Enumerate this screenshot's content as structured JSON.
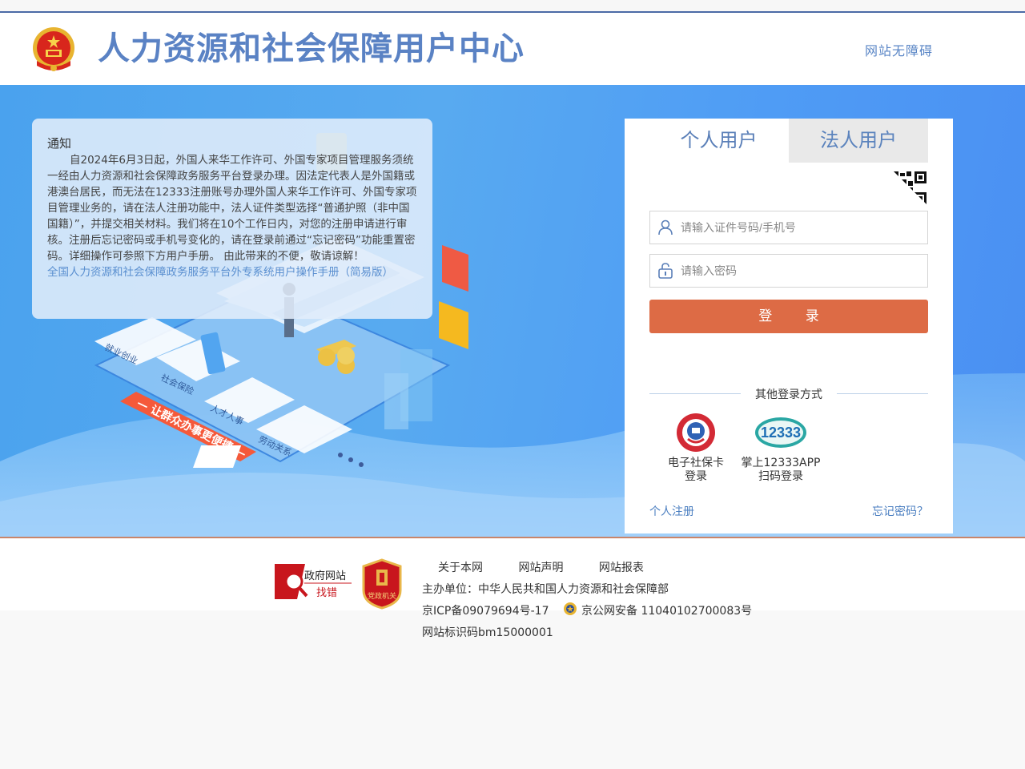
{
  "header": {
    "title": "人力资源和社会保障用户中心",
    "accessibility": "网站无障碍"
  },
  "notice": {
    "title": "通知",
    "body": "自2024年6月3日起，外国人来华工作许可、外国专家项目管理服务须统一经由人力资源和社会保障政务服务平台登录办理。因法定代表人是外国籍或港澳台居民，而无法在12333注册账号办理外国人来华工作许可、外国专家项目管理业务的，请在法人注册功能中，法人证件类型选择“普通护照（非中国国籍）”，并提交相关材料。我们将在10个工作日内，对您的注册申请进行审核。注册后忘记密码或手机号变化的，请在登录前通过“忘记密码”功能重置密码。详细操作可参照下方用户手册。 由此带来的不便，敬请谅解！",
    "link": "全国人力资源和社会保障政务服务平台外专系统用户操作手册（简易版）"
  },
  "illustration": {
    "tags": [
      "就业创业",
      "社会保险",
      "人才人事",
      "劳动关系"
    ],
    "slogan": "— 让群众办事更便捷 —"
  },
  "login": {
    "tabs": [
      "个人用户",
      "法人用户"
    ],
    "active_tab": "个人用户",
    "username_placeholder": "请输入证件号码/手机号",
    "password_placeholder": "请输入密码",
    "username_value": "",
    "password_value": "",
    "submit": "登 录",
    "other_title": "其他登录方式",
    "alt_options": [
      {
        "line1": "电子社保卡",
        "line2": "登录",
        "icon": "social-security-card-icon"
      },
      {
        "line1": "掌上12333APP",
        "line2": "扫码登录",
        "icon": "app-12333-icon"
      }
    ],
    "alt_icon_text": "12333",
    "register": "个人注册",
    "forgot": "忘记密码？"
  },
  "footer": {
    "badge_gov": [
      "政府网站",
      "找错"
    ],
    "badge_party": "党政机关",
    "links": [
      "关于本网",
      "网站声明",
      "网站报表"
    ],
    "sponsor": "主办单位：中华人民共和国人力资源和社会保障部",
    "icp": "京ICP备09079694号-17",
    "gongan": "京公网安备 11040102700083号",
    "site_code": "网站标识码bm15000001"
  },
  "colors": {
    "brand_blue": "#5a82c4",
    "login_button": "#dd6b45",
    "banner_blue": "#4f9cf5",
    "link_blue": "#4a7ec0"
  }
}
